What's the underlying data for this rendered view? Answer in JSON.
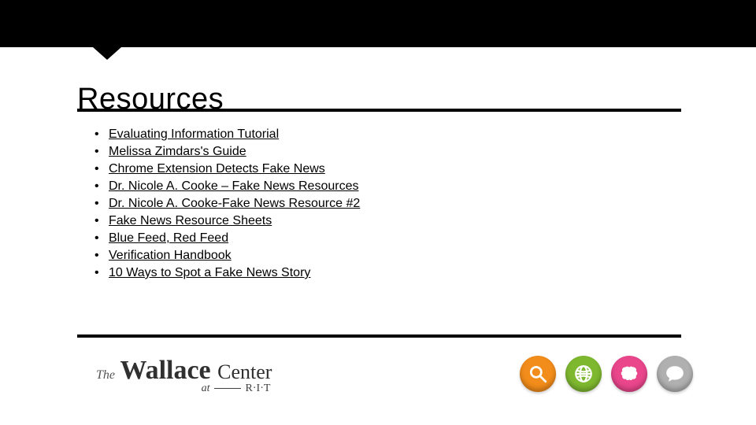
{
  "title": "Resources",
  "links": [
    "Evaluating Information Tutorial",
    "Melissa Zimdars's Guide",
    "Chrome Extension Detects Fake News",
    "Dr. Nicole A. Cooke – Fake News Resources",
    "Dr. Nicole A. Cooke-Fake News Resource #2",
    "Fake News Resource Sheets",
    "Blue Feed, Red Feed",
    "Verification Handbook",
    "10 Ways to Spot a Fake News Story"
  ],
  "footer": {
    "the": "The",
    "wallace": "Wallace",
    "center": "Center",
    "at": "at",
    "rit": "R·I·T"
  },
  "icons": [
    "search",
    "globe",
    "brain",
    "chat"
  ]
}
